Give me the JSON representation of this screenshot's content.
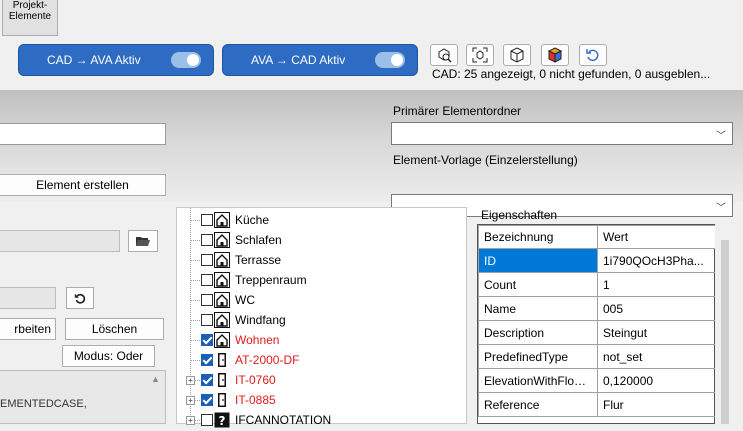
{
  "toolbar": {
    "projekt_label": "Projekt-\nElemente",
    "cad_ava_label": "CAD → AVA  Aktiv",
    "ava_cad_label": "AVA → CAD  Aktiv",
    "icons": [
      "zoom-selection-icon",
      "zoom-fit-icon",
      "cube-icon",
      "colored-cube-icon",
      "refresh-icon"
    ],
    "status": "CAD: 25 angezeigt, 0 nicht gefunden, 0 ausgeblen..."
  },
  "band": {
    "primary_folder_label": "Primärer Elementordner",
    "template_label": "Element-Vorlage (Einzelerstellung)",
    "create_button": "Element erstellen"
  },
  "left": {
    "edit_button": "rbeiten",
    "delete_button": "Löschen",
    "mode_button": "Modus: Oder",
    "list_text": "EMENTEDCASE,"
  },
  "tree": {
    "items": [
      {
        "label": "Küche",
        "checked": false,
        "red": false,
        "icon": "house"
      },
      {
        "label": "Schlafen",
        "checked": false,
        "red": false,
        "icon": "house"
      },
      {
        "label": "Terrasse",
        "checked": false,
        "red": false,
        "icon": "house"
      },
      {
        "label": "Treppenraum",
        "checked": false,
        "red": false,
        "icon": "house"
      },
      {
        "label": "WC",
        "checked": false,
        "red": false,
        "icon": "house"
      },
      {
        "label": "Windfang",
        "checked": false,
        "red": false,
        "icon": "house"
      },
      {
        "label": "Wohnen",
        "checked": true,
        "red": true,
        "icon": "house"
      },
      {
        "label": "AT-2000-DF",
        "checked": true,
        "red": true,
        "icon": "door"
      },
      {
        "label": "IT-0760",
        "checked": true,
        "red": true,
        "icon": "door"
      },
      {
        "label": "IT-0885",
        "checked": true,
        "red": true,
        "icon": "door"
      },
      {
        "label": "IFCANNOTATION",
        "checked": false,
        "red": false,
        "icon": "unknown"
      }
    ]
  },
  "properties": {
    "title": "Eigenschaften",
    "col_name": "Bezeichnung",
    "col_value": "Wert",
    "rows": [
      {
        "name": "ID",
        "value": "1i790QOcH3Pha..."
      },
      {
        "name": "Count",
        "value": "1"
      },
      {
        "name": "Name",
        "value": "005"
      },
      {
        "name": "Description",
        "value": "Steingut"
      },
      {
        "name": "PredefinedType",
        "value": "not_set"
      },
      {
        "name": "ElevationWithFloor...",
        "value": "0,120000"
      },
      {
        "name": "Reference",
        "value": "Flur"
      }
    ]
  },
  "colors": {
    "accent": "#2d6cc2",
    "selection": "#0078d7",
    "error": "#e01b1b"
  }
}
